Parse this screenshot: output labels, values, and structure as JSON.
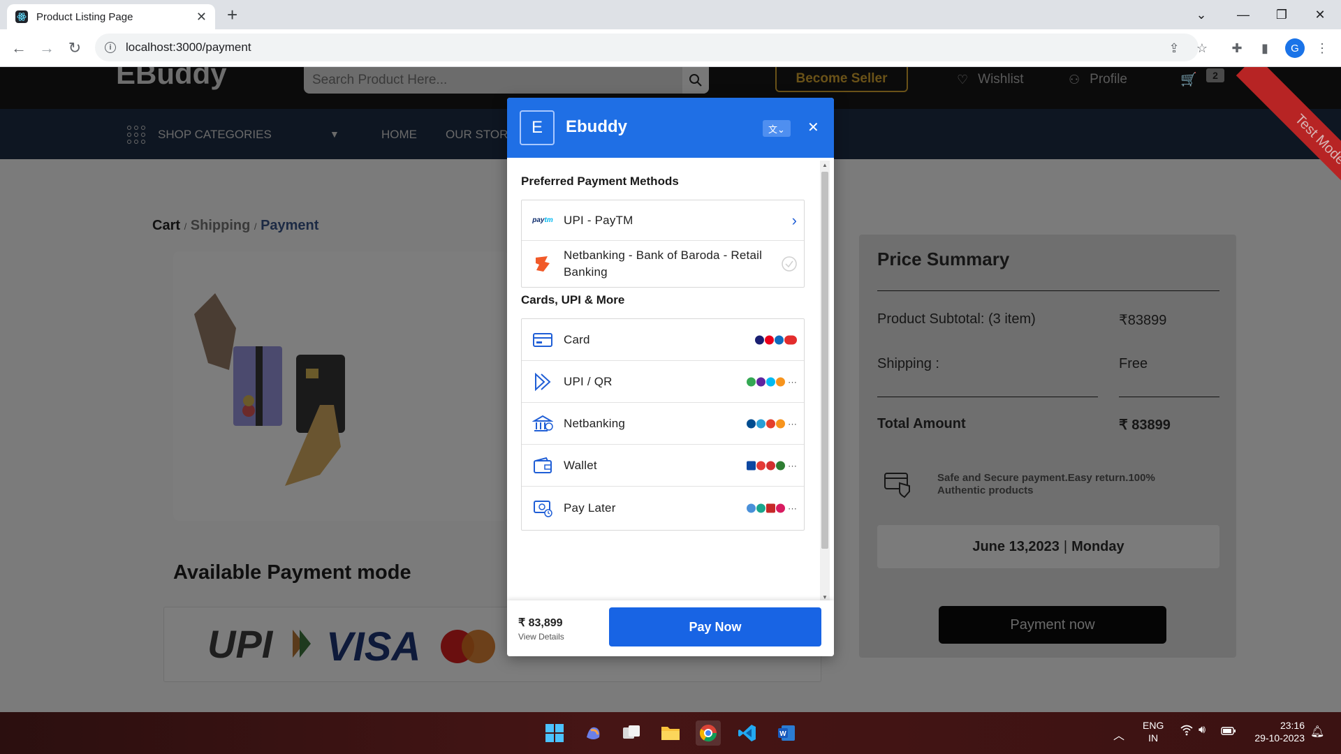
{
  "browser": {
    "tab_title": "Product Listing Page",
    "url": "localhost:3000/payment",
    "profile_initial": "G"
  },
  "site": {
    "logo": "EBuddy",
    "search_placeholder": "Search Product Here...",
    "become_seller": "Become Seller",
    "wishlist": "Wishlist",
    "profile": "Profile",
    "cart_count": "2",
    "shop_categories": "SHOP CATEGORIES",
    "nav_items": [
      "HOME",
      "OUR STORE"
    ],
    "breadcrumb": {
      "cart": "Cart",
      "sep1": "/",
      "shipping": "Shipping",
      "sep2": "/",
      "payment": "Payment"
    },
    "available_title": "Available Payment mode",
    "test_mode": "Test Mode"
  },
  "summary": {
    "title": "Price Summary",
    "subtotal_label": "Product Subtotal: (3 item)",
    "subtotal_value": "₹83899",
    "shipping_label": "Shipping :",
    "shipping_value": "Free",
    "total_label": "Total Amount",
    "total_value": "₹ 83899",
    "secure_text": "Safe and Secure payment.Easy return.100% Authentic products",
    "date": "June 13,2023",
    "day": "Monday",
    "payment_button": "Payment now"
  },
  "modal": {
    "initial": "E",
    "merchant": "Ebuddy",
    "preferred_title": "Preferred Payment Methods",
    "preferred": [
      {
        "label": "UPI - PayTM"
      },
      {
        "label": "Netbanking - Bank of Baroda - Retail Banking"
      }
    ],
    "more_title": "Cards, UPI & More",
    "methods": [
      {
        "label": "Card"
      },
      {
        "label": "UPI / QR"
      },
      {
        "label": "Netbanking"
      },
      {
        "label": "Wallet"
      },
      {
        "label": "Pay Later"
      }
    ],
    "amount": "₹ 83,899",
    "view_details": "View Details",
    "pay_now": "Pay Now"
  },
  "taskbar": {
    "lang1": "ENG",
    "lang2": "IN",
    "time": "23:16",
    "date": "29-10-2023"
  },
  "colors": {
    "modal_header": "#1f6fe5",
    "pay_button": "#1864e4",
    "ribbon": "#b72424"
  }
}
